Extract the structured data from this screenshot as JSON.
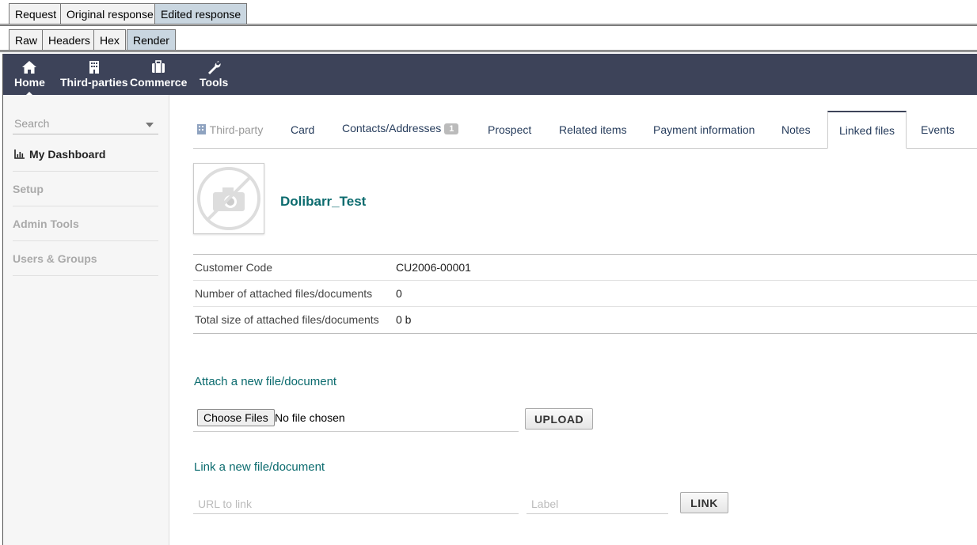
{
  "burp": {
    "top_tabs": [
      "Request",
      "Original response",
      "Edited response"
    ],
    "sub_tabs": [
      "Raw",
      "Headers",
      "Hex",
      "Render"
    ]
  },
  "nav": {
    "home": "Home",
    "third_parties": "Third-parties",
    "commerce": "Commerce",
    "tools": "Tools"
  },
  "sidebar": {
    "search_placeholder": "Search",
    "items": [
      "My Dashboard",
      "Setup",
      "Admin Tools",
      "Users & Groups"
    ]
  },
  "tabs": {
    "third_party": "Third-party",
    "card": "Card",
    "contacts": "Contacts/Addresses",
    "contacts_count": "1",
    "prospect": "Prospect",
    "related": "Related items",
    "payment": "Payment information",
    "notes": "Notes",
    "linked_files": "Linked files",
    "events": "Events"
  },
  "company": {
    "name": "Dolibarr_Test"
  },
  "info": [
    {
      "label": "Customer Code",
      "value": "CU2006-00001"
    },
    {
      "label": "Number of attached files/documents",
      "value": "0"
    },
    {
      "label": "Total size of attached files/documents",
      "value": "0 b"
    }
  ],
  "attach": {
    "title": "Attach a new file/document",
    "choose_label": "Choose Files",
    "no_file": "No file chosen",
    "upload": "UPLOAD"
  },
  "link": {
    "title": "Link a new file/document",
    "url_placeholder": "URL to link",
    "label_placeholder": "Label",
    "button": "LINK"
  },
  "colors": {
    "navbar": "#3d4359",
    "accent": "#0b6b6e"
  }
}
